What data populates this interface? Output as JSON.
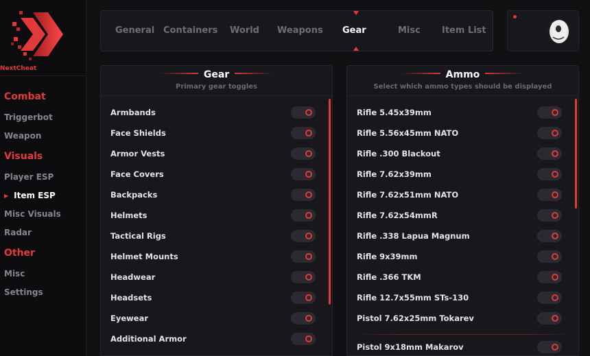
{
  "brand": {
    "name": "NextCheat",
    "accent": "#e23a3a"
  },
  "sidebar": {
    "sections": [
      {
        "label": "Combat",
        "items": [
          {
            "label": "Triggerbot"
          },
          {
            "label": "Weapon"
          }
        ]
      },
      {
        "label": "Visuals",
        "items": [
          {
            "label": "Player ESP"
          },
          {
            "label": "Item ESP",
            "active": true
          },
          {
            "label": "Misc Visuals"
          },
          {
            "label": "Radar"
          }
        ]
      },
      {
        "label": "Other",
        "items": [
          {
            "label": "Misc"
          },
          {
            "label": "Settings"
          }
        ]
      }
    ]
  },
  "tabs": [
    {
      "label": "General"
    },
    {
      "label": "Containers"
    },
    {
      "label": "World"
    },
    {
      "label": "Weapons"
    },
    {
      "label": "Gear",
      "active": true
    },
    {
      "label": "Misc"
    },
    {
      "label": "Item List"
    }
  ],
  "gear_panel": {
    "title": "Gear",
    "subtitle": "Primary gear toggles",
    "items": [
      {
        "label": "Armbands",
        "enabled": false
      },
      {
        "label": "Face Shields",
        "enabled": false
      },
      {
        "label": "Armor Vests",
        "enabled": false
      },
      {
        "label": "Face Covers",
        "enabled": false
      },
      {
        "label": "Backpacks",
        "enabled": false
      },
      {
        "label": "Helmets",
        "enabled": false
      },
      {
        "label": "Tactical Rigs",
        "enabled": false
      },
      {
        "label": "Helmet Mounts",
        "enabled": false
      },
      {
        "label": "Headwear",
        "enabled": false
      },
      {
        "label": "Headsets",
        "enabled": false
      },
      {
        "label": "Eyewear",
        "enabled": false
      },
      {
        "label": "Additional Armor",
        "enabled": false
      }
    ]
  },
  "ammo_panel": {
    "title": "Ammo",
    "subtitle": "Select which ammo types should be displayed",
    "items": [
      {
        "label": "Rifle 5.45x39mm",
        "enabled": false
      },
      {
        "label": "Rifle 5.56x45mm NATO",
        "enabled": false
      },
      {
        "label": "Rifle .300 Blackout",
        "enabled": false
      },
      {
        "label": "Rifle 7.62x39mm",
        "enabled": false
      },
      {
        "label": "Rifle 7.62x51mm NATO",
        "enabled": false
      },
      {
        "label": "Rifle 7.62x54mmR",
        "enabled": false
      },
      {
        "label": "Rifle .338 Lapua Magnum",
        "enabled": false
      },
      {
        "label": "Rifle 9x39mm",
        "enabled": false
      },
      {
        "label": "Rifle .366 TKM",
        "enabled": false
      },
      {
        "label": "Rifle 12.7x55mm STs-130",
        "enabled": false
      },
      {
        "label": "Pistol 7.62x25mm Tokarev",
        "enabled": false
      }
    ],
    "partial_item": {
      "label": "Pistol 9x18mm Makarov"
    }
  }
}
